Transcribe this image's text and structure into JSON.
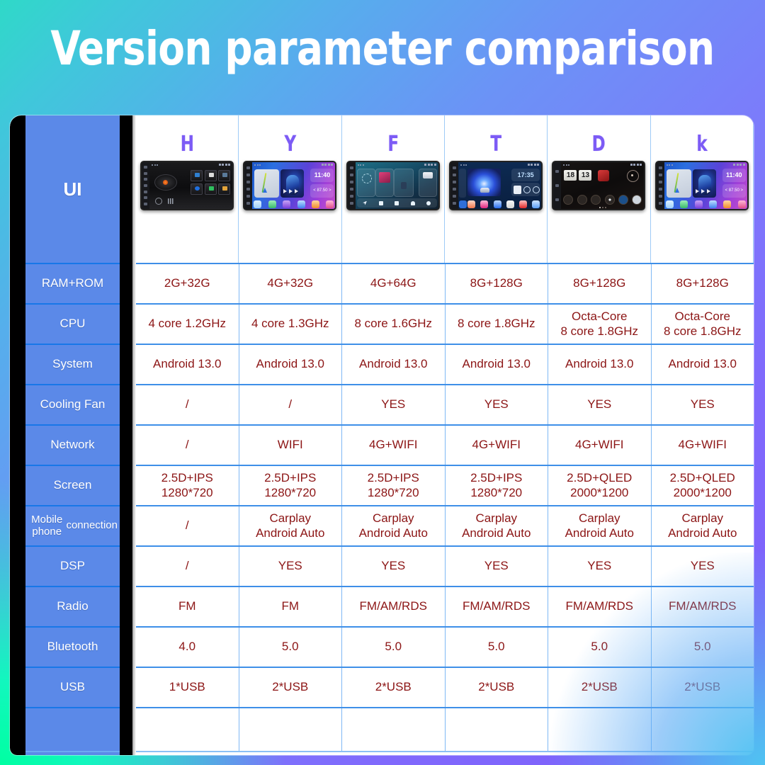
{
  "page": {
    "title": "Version parameter comparison",
    "accent_purple": "#7C5BF5",
    "label_blue": "#5B89E8",
    "value_red": "#8C1515",
    "grid_blue": "#3E8FE8"
  },
  "table": {
    "row_label_header": "UI",
    "columns": [
      {
        "letter": "H",
        "unit": "h-unit-screenshot"
      },
      {
        "letter": "Y",
        "unit": "y-unit-screenshot"
      },
      {
        "letter": "F",
        "unit": "f-unit-screenshot"
      },
      {
        "letter": "T",
        "unit": "t-unit-screenshot"
      },
      {
        "letter": "D",
        "unit": "d-unit-screenshot"
      },
      {
        "letter": "k",
        "unit": "k-unit-screenshot"
      }
    ],
    "rows": [
      {
        "label": "RAM+ROM",
        "values": [
          "2G+32G",
          "4G+32G",
          "4G+64G",
          "8G+128G",
          "8G+128G",
          "8G+128G"
        ]
      },
      {
        "label": "CPU",
        "values": [
          "4 core 1.2GHz",
          "4 core 1.3GHz",
          "8 core 1.6GHz",
          "8 core 1.8GHz",
          "Octa-Core\n8 core 1.8GHz",
          "Octa-Core\n8 core 1.8GHz"
        ]
      },
      {
        "label": "System",
        "values": [
          "Android 13.0",
          "Android 13.0",
          "Android 13.0",
          "Android 13.0",
          "Android 13.0",
          "Android 13.0"
        ]
      },
      {
        "label": "Cooling Fan",
        "values": [
          "/",
          "/",
          "YES",
          "YES",
          "YES",
          "YES"
        ]
      },
      {
        "label": "Network",
        "values": [
          "/",
          "WIFI",
          "4G+WIFI",
          "4G+WIFI",
          "4G+WIFI",
          "4G+WIFI"
        ]
      },
      {
        "label": "Screen",
        "values": [
          "2.5D+IPS\n1280*720",
          "2.5D+IPS\n1280*720",
          "2.5D+IPS\n1280*720",
          "2.5D+IPS\n1280*720",
          "2.5D+QLED\n2000*1200",
          "2.5D+QLED\n2000*1200"
        ]
      },
      {
        "label": "Mobile phone\nconnection",
        "values": [
          "/",
          "Carplay\nAndroid Auto",
          "Carplay\nAndroid Auto",
          "Carplay\nAndroid Auto",
          "Carplay\nAndroid Auto",
          "Carplay\nAndroid Auto"
        ]
      },
      {
        "label": "DSP",
        "values": [
          "/",
          "YES",
          "YES",
          "YES",
          "YES",
          "YES"
        ]
      },
      {
        "label": "Radio",
        "values": [
          "FM",
          "FM",
          "FM/AM/RDS",
          "FM/AM/RDS",
          "FM/AM/RDS",
          "FM/AM/RDS"
        ]
      },
      {
        "label": "Bluetooth",
        "values": [
          "4.0",
          "5.0",
          "5.0",
          "5.0",
          "5.0",
          "5.0"
        ]
      },
      {
        "label": "USB",
        "values": [
          "1*USB",
          "2*USB",
          "2*USB",
          "2*USB",
          "2*USB",
          "2*USB"
        ]
      },
      {
        "label": "",
        "values": [
          "",
          "",
          "",
          "",
          "",
          ""
        ]
      }
    ]
  },
  "unit_screens": {
    "y_clock": "11:40",
    "y_radio": "87.50",
    "t_clock": "17:35",
    "d_hour": "18",
    "d_minute": "13"
  }
}
